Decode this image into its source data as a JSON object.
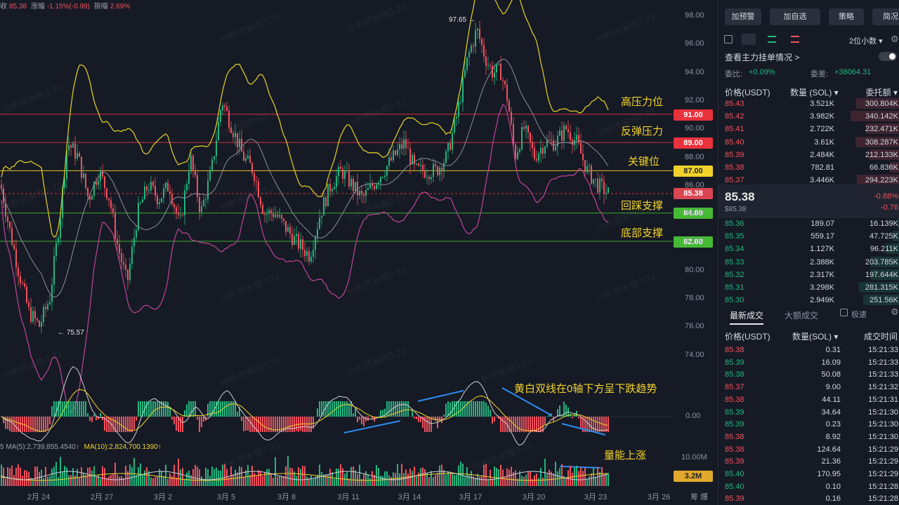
{
  "header": {
    "close_label": "收",
    "close": "85.38",
    "change_label": "涨幅",
    "change": "-1.15%(-0.99)",
    "amp_label": "振幅",
    "amp": "2.69%"
  },
  "watermark": "分析师米格3.23",
  "colors": {
    "up": "#24b47e",
    "down": "#f0525e",
    "yellow": "#f2d22a",
    "bg": "#161a25"
  },
  "price_axis": [
    "98.00",
    "96.00",
    "94.00",
    "92.00",
    "90.00",
    "88.00",
    "86.00",
    "84.00",
    "82.00",
    "80.00",
    "78.00",
    "76.00",
    "74.00"
  ],
  "macd_axis": "0.00",
  "volume_axis": "10.00M",
  "x_axis": [
    "2月 24",
    "2月 27",
    "3月 2",
    "3月 5",
    "3月 8",
    "3月 11",
    "3月 14",
    "3月 17",
    "3月 20",
    "3月 23",
    "3月 26"
  ],
  "x_axis_extra": "筹  爆",
  "levels": [
    {
      "price": "91.00",
      "label": "高压力位"
    },
    {
      "price": "89.00",
      "label": "反弹压力"
    },
    {
      "price": "87.00",
      "label": "关键位"
    },
    {
      "price": "85.38",
      "label": "回踩支撑"
    },
    {
      "price": "84.00",
      "label": ""
    },
    {
      "price": "82.00",
      "label": "底部支撑"
    }
  ],
  "extremes": {
    "high": "97.65 →",
    "low": "← 75.57"
  },
  "macd_note": "黄白双线在0轴下方呈下跌趋势",
  "volume_note": "量能上涨",
  "volume_tag": "3.2M",
  "ma_legend": {
    "ma5": "5  MA(5):2,739,855.4540↑",
    "ma10": "MA(10):2,824,700.1390↑"
  },
  "chart_data": {
    "type": "candlestick",
    "price_range": [
      73,
      99
    ],
    "high": 97.65,
    "low": 75.57,
    "last": 85.38,
    "levels": [
      91.0,
      89.0,
      87.0,
      85.38,
      84.0,
      82.0
    ]
  },
  "panel": {
    "buttons": [
      "加预警",
      "加自选",
      "策略",
      "简况"
    ],
    "precision": "2位小数 ▾",
    "orderbook_link": "查看主力挂单情况 >",
    "wei_bi_label": "委比:",
    "wei_bi": "+0.09%",
    "wei_cha_label": "委差:",
    "wei_cha": "+38064.31",
    "ob_headers": [
      "价格(USDT)",
      "数量 (SOL) ▾",
      "委托额 ▾"
    ],
    "asks": [
      [
        "85.43",
        "3.521K",
        "300.804K"
      ],
      [
        "85.42",
        "3.982K",
        "340.142K"
      ],
      [
        "85.41",
        "2.722K",
        "232.471K"
      ],
      [
        "85.40",
        "3.61K",
        "308.287K"
      ],
      [
        "85.39",
        "2.484K",
        "212.133K"
      ],
      [
        "85.38",
        "782.81",
        "66.836K"
      ],
      [
        "85.37",
        "3.446K",
        "294.223K"
      ]
    ],
    "last_price": "85.38",
    "last_sub": "$85.38",
    "last_pct": "-0.88%",
    "last_chg": "-0.76",
    "bids": [
      [
        "85.36",
        "189.07",
        "16.139K"
      ],
      [
        "85.35",
        "559.17",
        "47.725K"
      ],
      [
        "85.34",
        "1.127K",
        "96.211K"
      ],
      [
        "85.33",
        "2.388K",
        "203.785K"
      ],
      [
        "85.32",
        "2.317K",
        "197.644K"
      ],
      [
        "85.31",
        "3.298K",
        "281.315K"
      ],
      [
        "85.30",
        "2.949K",
        "251.56K"
      ]
    ],
    "trade_tabs": [
      "最新成交",
      "大额成交"
    ],
    "trade_filter": "极速",
    "trade_headers": [
      "价格(USDT)",
      "数量(SOL) ▾",
      "成交时间"
    ],
    "trades": [
      [
        "85.38",
        "0.31",
        "15:21:33",
        "d"
      ],
      [
        "85.39",
        "16.09",
        "15:21:33",
        "u"
      ],
      [
        "85.38",
        "50.08",
        "15:21:33",
        "u"
      ],
      [
        "85.37",
        "9.00",
        "15:21:32",
        "d"
      ],
      [
        "85.38",
        "44.11",
        "15:21:31",
        "d"
      ],
      [
        "85.39",
        "34.64",
        "15:21:30",
        "u"
      ],
      [
        "85.39",
        "0.23",
        "15:21:30",
        "u"
      ],
      [
        "85.38",
        "8.92",
        "15:21:30",
        "d"
      ],
      [
        "85.38",
        "124.64",
        "15:21:29",
        "d"
      ],
      [
        "85.39",
        "21.36",
        "15:21:29",
        "d"
      ],
      [
        "85.40",
        "170.95",
        "15:21:29",
        "u"
      ],
      [
        "85.40",
        "0.10",
        "15:21:28",
        "u"
      ],
      [
        "85.39",
        "0.16",
        "15:21:28",
        "d"
      ]
    ]
  }
}
